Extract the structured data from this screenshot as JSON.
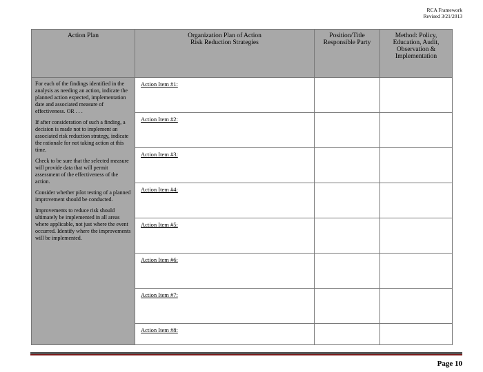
{
  "header": {
    "title": "RCA Framework",
    "revised": "Revised 3/21/2013"
  },
  "columns": {
    "plan": "Action Plan",
    "orgLine1": "Organization Plan of Action",
    "orgLine2": "Risk Reduction Strategies",
    "party": "Position/Title Responsible Party",
    "methodLine1": "Method: Policy,",
    "methodLine2": "Education, Audit,",
    "methodLine3": "Observation &",
    "methodLine4": "Implementation"
  },
  "instructions": {
    "p1": "For each of the findings identified in the analysis as needing an action, indicate the planned action expected, implementation date and associated measure of effectiveness.  OR . . .",
    "p2": "If after consideration of such a finding, a decision is made not to implement an associated risk reduction strategy, indicate the rationale for not taking action at this time.",
    "p3": "Check to be sure that the selected measure will provide data that will permit assessment of the effectiveness of the action.",
    "p4": "Consider whether pilot testing of a planned improvement should be conducted.",
    "p5": "Improvements to reduce risk should ultimately be implemented in all areas where applicable, not just where the event occurred.  Identify where the improvements will be implemented."
  },
  "items": [
    "Action Item #1:",
    "Action Item #2:",
    "Action Item #3:",
    "Action Item #4:",
    "Action Item #5:",
    "Action Item #6:",
    "Action Item #7:",
    "Action Item #8:"
  ],
  "footer": {
    "page": "Page 10"
  }
}
